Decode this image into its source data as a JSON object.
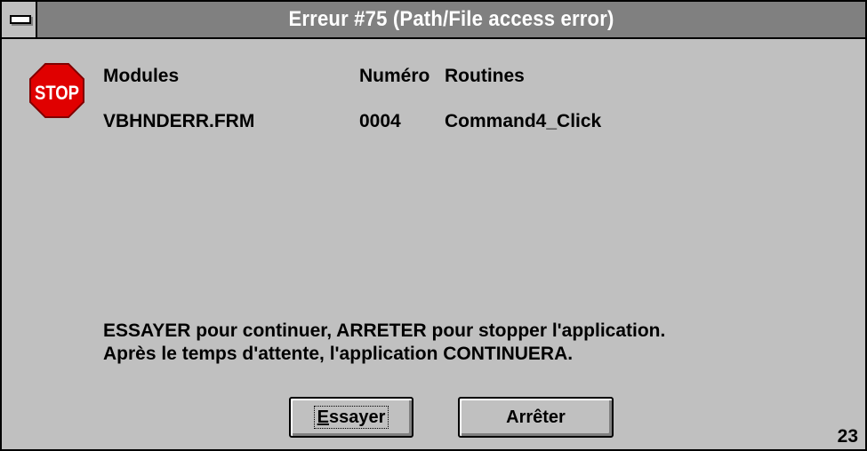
{
  "window": {
    "title": "Erreur #75 (Path/File access error)"
  },
  "icon": {
    "name": "stop-icon",
    "text": "STOP",
    "color": "#e00000"
  },
  "table": {
    "headers": {
      "modules": "Modules",
      "numero": "Numéro",
      "routines": "Routines"
    },
    "row": {
      "module": "VBHNDERR.FRM",
      "numero": "0004",
      "routine": "Command4_Click"
    }
  },
  "message": {
    "line1": "ESSAYER pour continuer, ARRETER pour stopper l'application.",
    "line2": "Après le temps d'attente, l'application CONTINUERA."
  },
  "buttons": {
    "essayer_mnemonic": "E",
    "essayer_rest": "ssayer",
    "arreter": "Arrêter"
  },
  "countdown": "23"
}
